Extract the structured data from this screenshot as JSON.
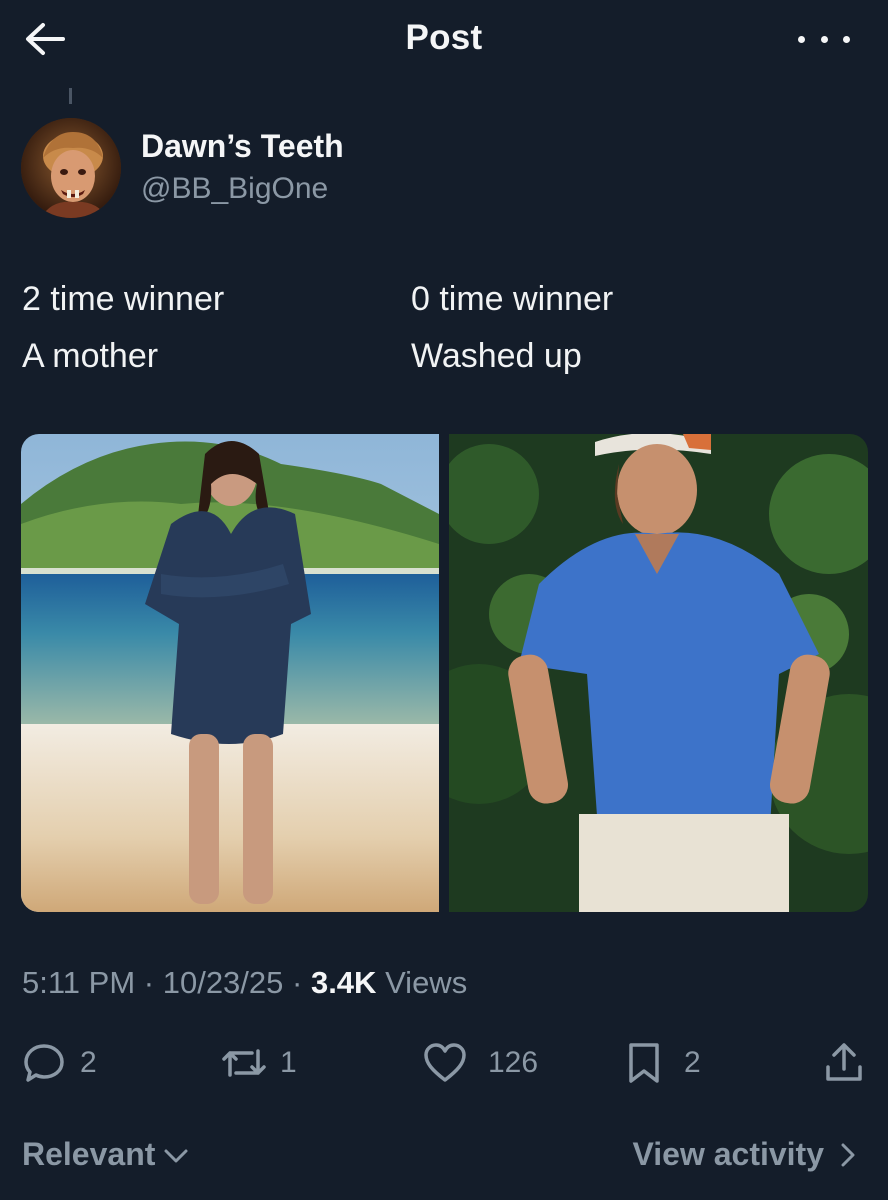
{
  "header": {
    "title": "Post",
    "back_icon": "arrow-left-icon",
    "more_icon": "more-horizontal-icon"
  },
  "author": {
    "name": "Dawn’s Teeth",
    "handle": "@BB_BigOne"
  },
  "post": {
    "left_line1": "2 time winner",
    "left_line2": "A mother",
    "right_line1": "0 time winner",
    "right_line2": "Washed up"
  },
  "meta": {
    "time": "5:11 PM",
    "date": "10/23/25",
    "views_count": "3.4K",
    "views_label": "Views"
  },
  "actions": {
    "replies": "2",
    "reposts": "1",
    "likes": "126",
    "bookmarks": "2"
  },
  "footer": {
    "sort_label": "Relevant",
    "activity_label": "View activity"
  },
  "colors": {
    "background": "#141d2a",
    "text_primary": "#f5f6f7",
    "text_secondary": "#8b98a5"
  }
}
